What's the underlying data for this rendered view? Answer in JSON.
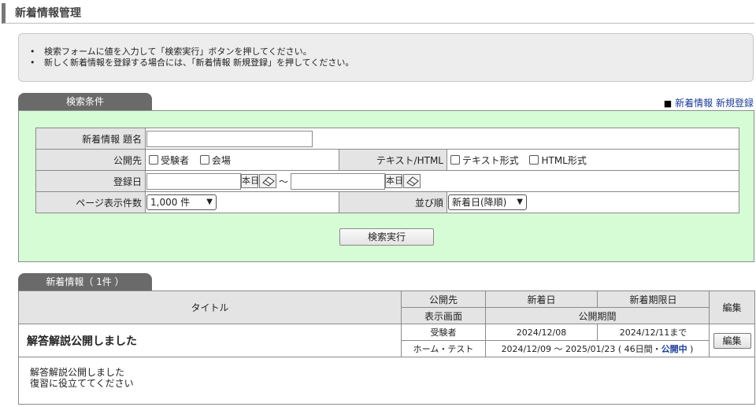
{
  "page": {
    "title": "新着情報管理"
  },
  "notice": {
    "lines": [
      "検索フォームに値を入力して「検索実行」ボタンを押してください。",
      "新しく新着情報を登録する場合には、「新着情報 新規登録」を押してください。"
    ]
  },
  "search": {
    "tab_label": "検索条件",
    "new_link": "新着情報 新規登録",
    "title_label": "新着情報 題名",
    "title_value": "",
    "target_label": "公開先",
    "target_options": [
      "受験者",
      "会場"
    ],
    "format_label": "テキスト/HTML",
    "format_options": [
      "テキスト形式",
      "HTML形式"
    ],
    "date_label": "登録日",
    "date_from": "",
    "date_to": "",
    "today_btn": "本日",
    "range_sep": "～",
    "page_size_label": "ページ表示件数",
    "page_size_value": "1,000 件",
    "sort_label": "並び順",
    "sort_value": "新着日(降順)",
    "submit_label": "検索実行"
  },
  "results": {
    "tab_label": "新着情報（ 1件 ）",
    "headers": {
      "title": "タイトル",
      "target": "公開先",
      "new_date": "新着日",
      "new_end": "新着期限日",
      "edit": "編集",
      "screen": "表示画面",
      "period": "公開期間"
    },
    "rows": [
      {
        "title": "解答解説公開しました",
        "target": "受験者",
        "new_date": "2024/12/08",
        "new_end": "2024/12/11まで",
        "screen": "ホーム・テスト",
        "period_prefix": "2024/12/09 ～ 2025/01/23 ( 46日間・",
        "status": "公開中",
        "period_suffix": " )",
        "edit_label": "編集",
        "body_lines": [
          "解答解説公開しました",
          "復習に役立ててください"
        ]
      }
    ]
  }
}
